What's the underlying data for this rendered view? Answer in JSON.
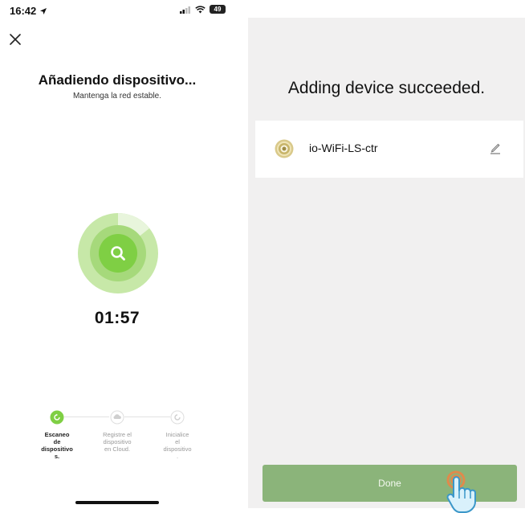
{
  "left_screen": {
    "status_bar": {
      "time": "16:42",
      "battery": "49"
    },
    "title": "Añadiendo dispositivo...",
    "subtitle": "Mantenga la red estable.",
    "timer": "01:57",
    "steps": [
      {
        "label": "Escaneo de dispositivo s.",
        "lines": [
          "Escaneo",
          "de",
          "dispositivo",
          "s."
        ],
        "state": "active",
        "icon": "refresh-icon"
      },
      {
        "label": "Registre el dispositivo en Cloud.",
        "lines": [
          "Registre el",
          "dispositivo",
          "en Cloud."
        ],
        "state": "inactive",
        "icon": "cloud-icon"
      },
      {
        "label": "Inicialice el dispositivo .",
        "lines": [
          "Inicialice",
          "el",
          "dispositivo",
          "."
        ],
        "state": "inactive",
        "icon": "cycle-icon"
      }
    ],
    "colors": {
      "accent": "#7fcf44",
      "ring_light": "#c7e8a8",
      "ring_mid": "#a6d97b"
    }
  },
  "right_screen": {
    "title": "Adding device succeeded.",
    "device": {
      "name": "io-WiFi-LS-ctr",
      "icon": "device-roll-icon"
    },
    "done_label": "Done",
    "colors": {
      "background": "#f1f0f0",
      "button": "#8bb47a"
    }
  }
}
